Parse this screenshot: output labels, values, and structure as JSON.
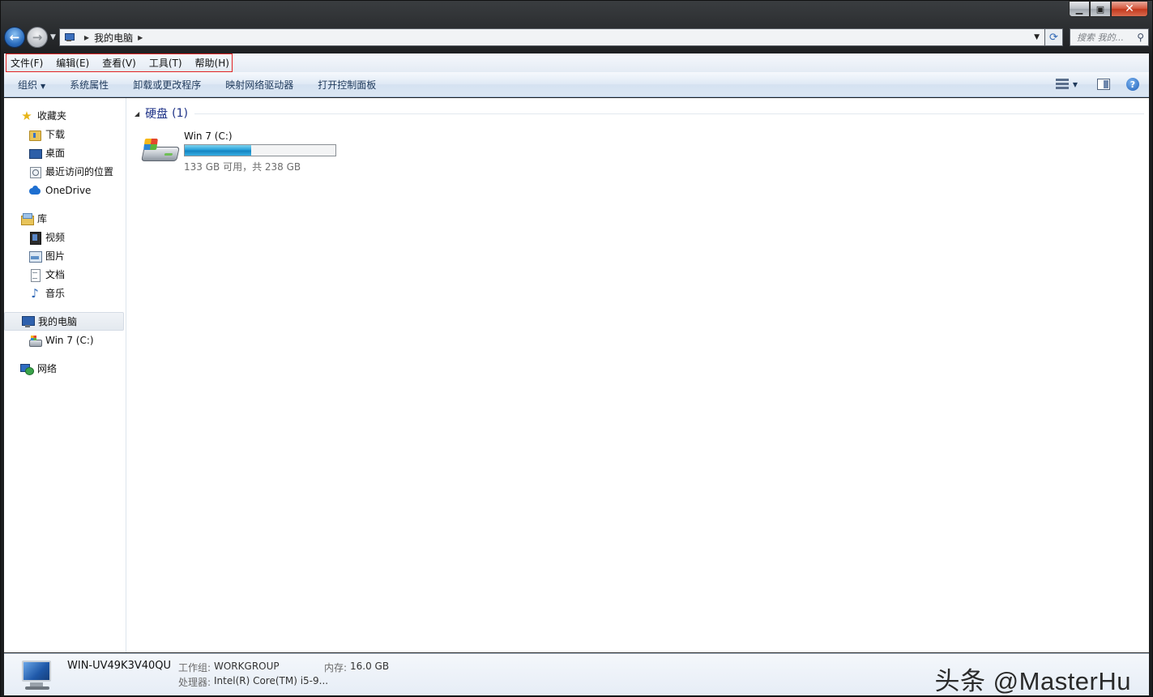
{
  "address": {
    "path": [
      "我的电脑"
    ]
  },
  "search": {
    "placeholder": "搜索 我的..."
  },
  "menubar": {
    "items": [
      "文件(F)",
      "编辑(E)",
      "查看(V)",
      "工具(T)",
      "帮助(H)"
    ]
  },
  "commandbar": {
    "organize": "组织",
    "items": [
      "系统属性",
      "卸载或更改程序",
      "映射网络驱动器",
      "打开控制面板"
    ]
  },
  "navpane": {
    "favorites": {
      "label": "收藏夹",
      "items": [
        "下载",
        "桌面",
        "最近访问的位置",
        "OneDrive"
      ]
    },
    "libraries": {
      "label": "库",
      "items": [
        "视频",
        "图片",
        "文档",
        "音乐"
      ]
    },
    "computer": {
      "label": "我的电脑",
      "items": [
        "Win 7 (C:)"
      ]
    },
    "network": {
      "label": "网络"
    }
  },
  "main": {
    "group_title": "硬盘",
    "group_count": "(1)",
    "drive": {
      "name": "Win 7 (C:)",
      "space_text": "133 GB 可用，共 238 GB",
      "free_gb": 133,
      "total_gb": 238,
      "used_fraction": 0.44
    }
  },
  "details": {
    "computer_name": "WIN-UV49K3V40QU",
    "workgroup_label": "工作组:",
    "workgroup_value": "WORKGROUP",
    "memory_label": "内存:",
    "memory_value": "16.0 GB",
    "cpu_label": "处理器:",
    "cpu_value": "Intel(R) Core(TM) i5-9..."
  },
  "watermark": "头条 @MasterHu",
  "colors": {
    "menu_highlight_border": "#e12323",
    "group_title": "#1e3287",
    "drive_bar_fill": "#26a0da"
  }
}
